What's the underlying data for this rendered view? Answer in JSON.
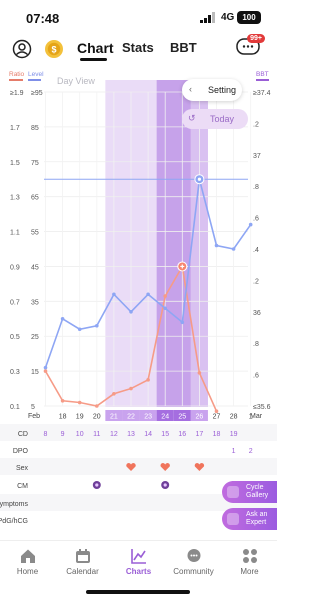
{
  "status": {
    "time": "07:48",
    "network": "4G",
    "battery": "100"
  },
  "header": {
    "tabs": [
      {
        "label": "Chart"
      },
      {
        "label": "Stats"
      },
      {
        "label": "BBT"
      }
    ],
    "notification_count": "99+"
  },
  "chart": {
    "left_axis": {
      "ratio_title": "Ratio",
      "level_title": "Level"
    },
    "right_axis_title": "BBT",
    "day_view_label": "Day View",
    "setting_label": "Setting",
    "today_label": "Today",
    "ratio_ticks": [
      "≥1.9",
      "1.7",
      "1.5",
      "1.3",
      "1.1",
      "0.9",
      "0.7",
      "0.5",
      "0.3",
      "0.1"
    ],
    "level_ticks": [
      "≥95",
      "85",
      "75",
      "65",
      "55",
      "45",
      "35",
      "25",
      "15",
      "5"
    ],
    "bbt_ticks": [
      "≥37.4",
      ".2",
      "37",
      ".8",
      ".6",
      ".4",
      ".2",
      "36",
      ".8",
      ".6",
      "≤35.6"
    ],
    "months": {
      "start": "Feb",
      "end": "Mar"
    },
    "dates": [
      "18",
      "19",
      "20",
      "21",
      "22",
      "23",
      "24",
      "25",
      "26",
      "27",
      "28",
      "1"
    ],
    "row_labels": [
      "CD",
      "DPO",
      "Sex",
      "CM",
      "Symptoms",
      "PdG/hCG"
    ],
    "cd_values": [
      "8",
      "9",
      "10",
      "11",
      "12",
      "13",
      "14",
      "15",
      "16",
      "17",
      "18",
      "19"
    ],
    "dpo_values": [
      "",
      "",
      "",
      "",
      "",
      "",
      "",
      "",
      "",
      "",
      "1",
      "2"
    ]
  },
  "chart_data": {
    "type": "line",
    "x": [
      "Feb 17",
      "Feb 18",
      "Feb 19",
      "Feb 20",
      "Feb 21",
      "Feb 22",
      "Feb 23",
      "Feb 24",
      "Feb 25",
      "Feb 26",
      "Feb 27",
      "Feb 28",
      "Mar 1"
    ],
    "series": [
      {
        "name": "Level",
        "color": "#8ea6f4",
        "values": [
          16,
          30,
          27,
          28,
          37,
          32,
          37,
          33,
          29,
          70,
          51,
          50,
          57
        ]
      },
      {
        "name": "Ratio",
        "color": "#f69b87",
        "values": [
          0.3,
          0.13,
          0.12,
          0.1,
          0.17,
          0.2,
          0.25,
          0.73,
          0.9,
          0.29,
          0.07
        ]
      }
    ],
    "bbt_reference": 36.9,
    "fertile_window": [
      "Feb 21",
      "Feb 26"
    ],
    "peak_days": [
      "Feb 24",
      "Feb 25"
    ],
    "sex_days": [
      "Feb 22",
      "Feb 24",
      "Feb 26"
    ],
    "cm_days": [
      "Feb 20",
      "Feb 24",
      "Feb 28"
    ],
    "ylim_level": [
      5,
      95
    ],
    "ylim_ratio": [
      0.1,
      1.9
    ],
    "ylim_bbt": [
      35.6,
      37.4
    ]
  },
  "side_buttons": [
    {
      "label": "Cycle Gallery"
    },
    {
      "label": "Ask an Expert"
    }
  ],
  "nav": [
    {
      "label": "Home"
    },
    {
      "label": "Calendar"
    },
    {
      "label": "Charts"
    },
    {
      "label": "Community"
    },
    {
      "label": "More"
    }
  ],
  "colors": {
    "accent": "#9a5ed6",
    "lh_line": "#8ea6f4",
    "ratio_line": "#f69b87"
  }
}
